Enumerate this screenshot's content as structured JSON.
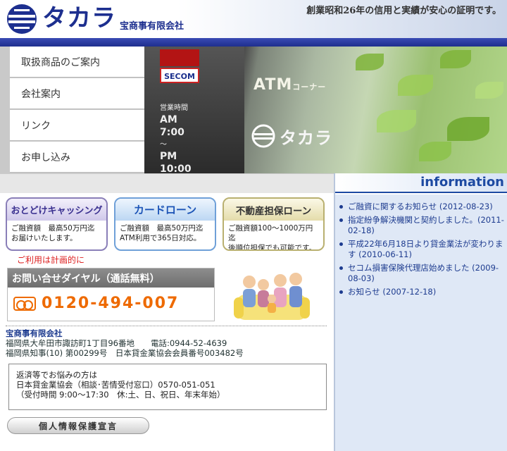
{
  "header": {
    "brand": "タカラ",
    "company_sub": "宝商事有限会社",
    "tagline": "創業昭和26年の信用と実績が安心の証明です。"
  },
  "nav": {
    "items": [
      {
        "label": "取扱商品のご案内"
      },
      {
        "label": "会社案内"
      },
      {
        "label": "リンク"
      },
      {
        "label": "お申し込み"
      }
    ]
  },
  "hero": {
    "secom": "SECOM",
    "hours_title": "営業時間",
    "hours_am": "AM 7:00",
    "hours_sep": "〜",
    "hours_pm": "PM 10:00",
    "atm": "ATM",
    "atm_suffix": "コーナー",
    "brand": "タカラ"
  },
  "info": {
    "title": "information",
    "items": [
      {
        "text": "ご融資に関するお知らせ (2012-08-23)"
      },
      {
        "text": "指定紛争解決機関と契約しました。(2011-02-18)"
      },
      {
        "text": "平成22年6月18日より貸金業法が変わります (2010-06-11)"
      },
      {
        "text": "セコム損害保険代理店始めました (2009-08-03)"
      },
      {
        "text": "お知らせ (2007-12-18)"
      }
    ]
  },
  "cards": [
    {
      "title": "おとどけキャッシング",
      "line1": "ご融資額　最高50万円迄",
      "line2": "お届けいたします。"
    },
    {
      "title": "カードローン",
      "line1": "ご融資額　最高50万円迄",
      "line2": "ATM利用で365日対応。"
    },
    {
      "title": "不動産担保ローン",
      "line1": "ご融資額100〜1000万円迄",
      "line2": "後順位担保でも可能です。"
    }
  ],
  "plan_note": "ご利用は計画的に",
  "phone": {
    "heading": "お問い合せダイヤル（通話無料）",
    "number": "0120-494-007"
  },
  "company": {
    "name": "宝商事有限会社",
    "address": "福岡県大牟田市諏訪町1丁目96番地　　電話:0944-52-4639",
    "license": "福岡県知事(10) 第00299号　日本貸金業協会会員番号003482号"
  },
  "consult": {
    "line1": "返済等でお悩みの方は",
    "line2": "日本貸金業協会（相談･苦情受付窓口）0570-051-051",
    "line3": "（受付時間 9:00〜17:30　休:土、日、祝日、年末年始）"
  },
  "privacy_button": "個人情報保護宣言",
  "colors": {
    "brand_blue": "#1d2f8f",
    "info_blue": "#1d4aa2",
    "phone_orange": "#ee6a00",
    "note_red": "#dd2222"
  }
}
